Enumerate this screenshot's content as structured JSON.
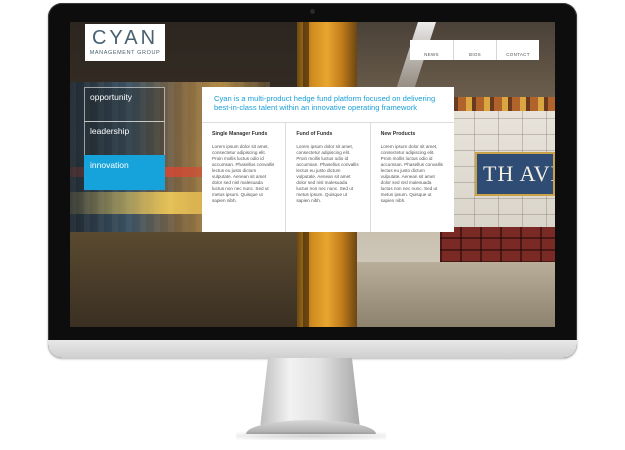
{
  "logo": {
    "main": "CYAN",
    "sub": "MANAGEMENT GROUP"
  },
  "nav": {
    "items": [
      "NEWS",
      "BIOS",
      "CONTACT"
    ]
  },
  "sidebar": {
    "items": [
      "opportunity",
      "leadership",
      "innovation"
    ],
    "active_index": 2
  },
  "panel": {
    "heading": "Cyan is a multi-product hedge fund platform focused on delivering best-in-class talent within an innovative operating framework",
    "columns": [
      {
        "title": "Single Manager Funds",
        "body": "Lorem ipsum dolor sit amet, consectetur adipiscing elit. Proin mollis luctus odio id accumsan. Phasellus convallis lectus eu justo dictum vulputate. Aenean sit amet dolor sed nisl malesuada luctus non nec nunc. Sed ut metus ipsum. Quisque ut sapien nibh."
      },
      {
        "title": "Fund of Funds",
        "body": "Lorem ipsum dolor sit amet, consectetur adipiscing elit. Proin mollis luctus odio id accumsan. Phasellus convallis lectus eu justo dictum vulputate. Aenean sit amet dolor sed nisl malesuada luctus non nec nunc. Sed ut metus ipsum. Quisque ut sapien nibh."
      },
      {
        "title": "New Products",
        "body": "Lorem ipsum dolor sit amet, consectetur adipiscing elit. Proin mollis luctus odio id accumsan. Phasellus convallis lectus eu justo dictum vulputate. Aenean sit amet dolor sed nisl malesuada luctus non nec nunc. Sed ut metus ipsum. Quisque ut sapien nibh."
      }
    ]
  },
  "background": {
    "sign_text": "TH AVE."
  },
  "colors": {
    "accent": "#16a3dc",
    "heading": "#1aa0d8",
    "logo": "#4a6172"
  }
}
